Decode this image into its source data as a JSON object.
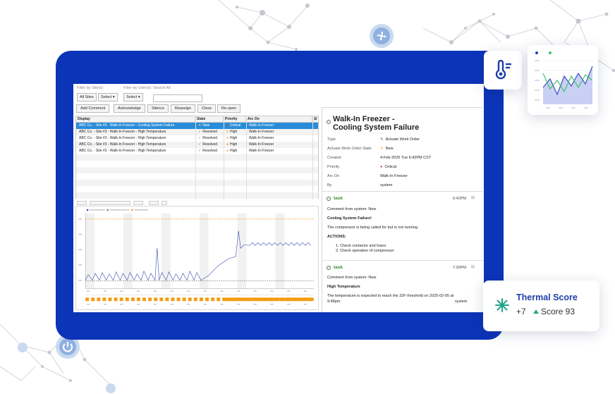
{
  "colors": {
    "frame": "#0c34b8",
    "selected_row": "#2a8cd8",
    "critical": "#e53935",
    "high": "#f39c12",
    "resolved": "#4caf50",
    "task_green": "#3a8a2e",
    "score_blue": "#1f3fa8"
  },
  "filters": {
    "site_label": "Filter by Site(s)",
    "user_label": "Filter by User(s)",
    "search_label": "Search All",
    "all_sites": "All Sites",
    "select_site": "Select",
    "select_user": "Select"
  },
  "actions": [
    "Add Comment",
    "Acknowledge",
    "Silence",
    "Reassign",
    "Close",
    "Re-open"
  ],
  "grid": {
    "columns": [
      "Display",
      "State",
      "Priority",
      "Arc On"
    ],
    "rows": [
      {
        "display": "ABC Co. - Site #3 - Walk-In Freezer - Cooling System Failure",
        "state": "New",
        "state_icon": "sun-icon",
        "priority": "Critical",
        "arc_on": "Walk-In Freezer",
        "selected": true
      },
      {
        "display": "ABC Co. - Site #3 - Walk-In Freezer - High Temperature",
        "state": "Resolved",
        "state_icon": "check-icon",
        "priority": "High",
        "arc_on": "Walk-In Freezer",
        "selected": false
      },
      {
        "display": "ABC Co. - Site #3 - Walk-In Freezer - High Temperature",
        "state": "Resolved",
        "state_icon": "check-icon",
        "priority": "High",
        "arc_on": "Walk-In Freezer",
        "selected": false
      },
      {
        "display": "ABC Co. - Site #3 - Walk-In Freezer - High Temperature",
        "state": "Resolved",
        "state_icon": "check-icon",
        "priority": "High",
        "arc_on": "Walk-In Freezer",
        "selected": false
      },
      {
        "display": "ABC Co. - Site #3 - Walk-In Freezer - High Temperature",
        "state": "Resolved",
        "state_icon": "check-icon",
        "priority": "High",
        "arc_on": "Walk-In Freezer",
        "selected": false
      }
    ]
  },
  "detail": {
    "title_line1": "Walk-In Freezer -",
    "title_line2": "Cooling System Failure",
    "fields": [
      {
        "label": "Type",
        "value": "Actuate Work Order",
        "icon": "wrench-icon"
      },
      {
        "label": "Actuate Work Order State",
        "value": "New",
        "icon": "sun-icon"
      },
      {
        "label": "Created",
        "value": "4-Feb-2025 Tue 6:42PM CST",
        "icon": ""
      },
      {
        "label": "Priority",
        "value": "Critical",
        "icon": "red-dot-icon"
      },
      {
        "label": "Arc On",
        "value": "Walk-In Freezer",
        "icon": ""
      },
      {
        "label": "By",
        "value": "system",
        "icon": ""
      }
    ],
    "tasks": [
      {
        "label": "task",
        "time": "6:42PM",
        "comment": "Comment from system: New",
        "heading": "Cooling System Failure!",
        "body": "The compressor is being called for but is not running.",
        "actions_label": "ACTIONS:",
        "actions": [
          "1. Check contactor and fuses",
          "2. Check operation of compressor"
        ]
      },
      {
        "label": "task",
        "time": "7:00PM",
        "comment": "Comment from system: New",
        "heading": "High Temperature",
        "body": "The temperature is expected to reach the 32F threshold on 2025-02-05 at",
        "body2": "9:48pm.",
        "by": "system"
      }
    ]
  },
  "score": {
    "title": "Thermal Score",
    "delta": "+7",
    "label": "Score 93"
  }
}
